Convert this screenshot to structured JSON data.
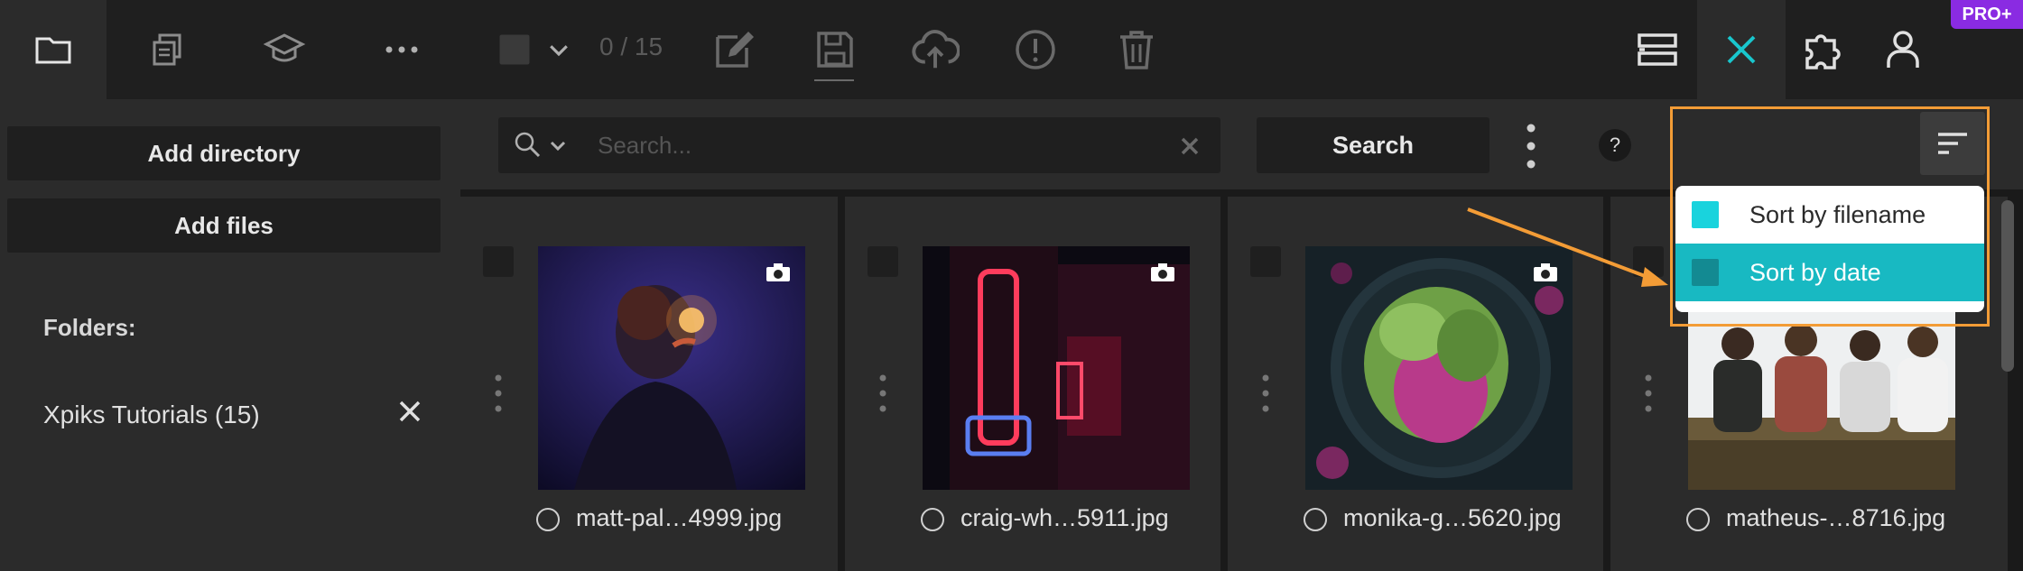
{
  "toolbar": {
    "counter": "0 / 15",
    "pro_badge": "PRO+",
    "accent": "#19c6cd"
  },
  "sidebar": {
    "add_directory": "Add directory",
    "add_files": "Add files",
    "folders_label": "Folders:",
    "folders": [
      {
        "label": "Xpiks Tutorials (15)"
      }
    ]
  },
  "search": {
    "placeholder": "Search...",
    "button_label": "Search",
    "help": "?"
  },
  "sort_menu": {
    "items": [
      {
        "label": "Sort by filename",
        "selected": false
      },
      {
        "label": "Sort by date",
        "selected": true
      }
    ],
    "highlight_color": "#f39c36"
  },
  "files": [
    {
      "name": "matt-pal…4999.jpg"
    },
    {
      "name": "craig-wh…5911.jpg"
    },
    {
      "name": "monika-g…5620.jpg"
    },
    {
      "name": "matheus-…8716.jpg"
    }
  ]
}
